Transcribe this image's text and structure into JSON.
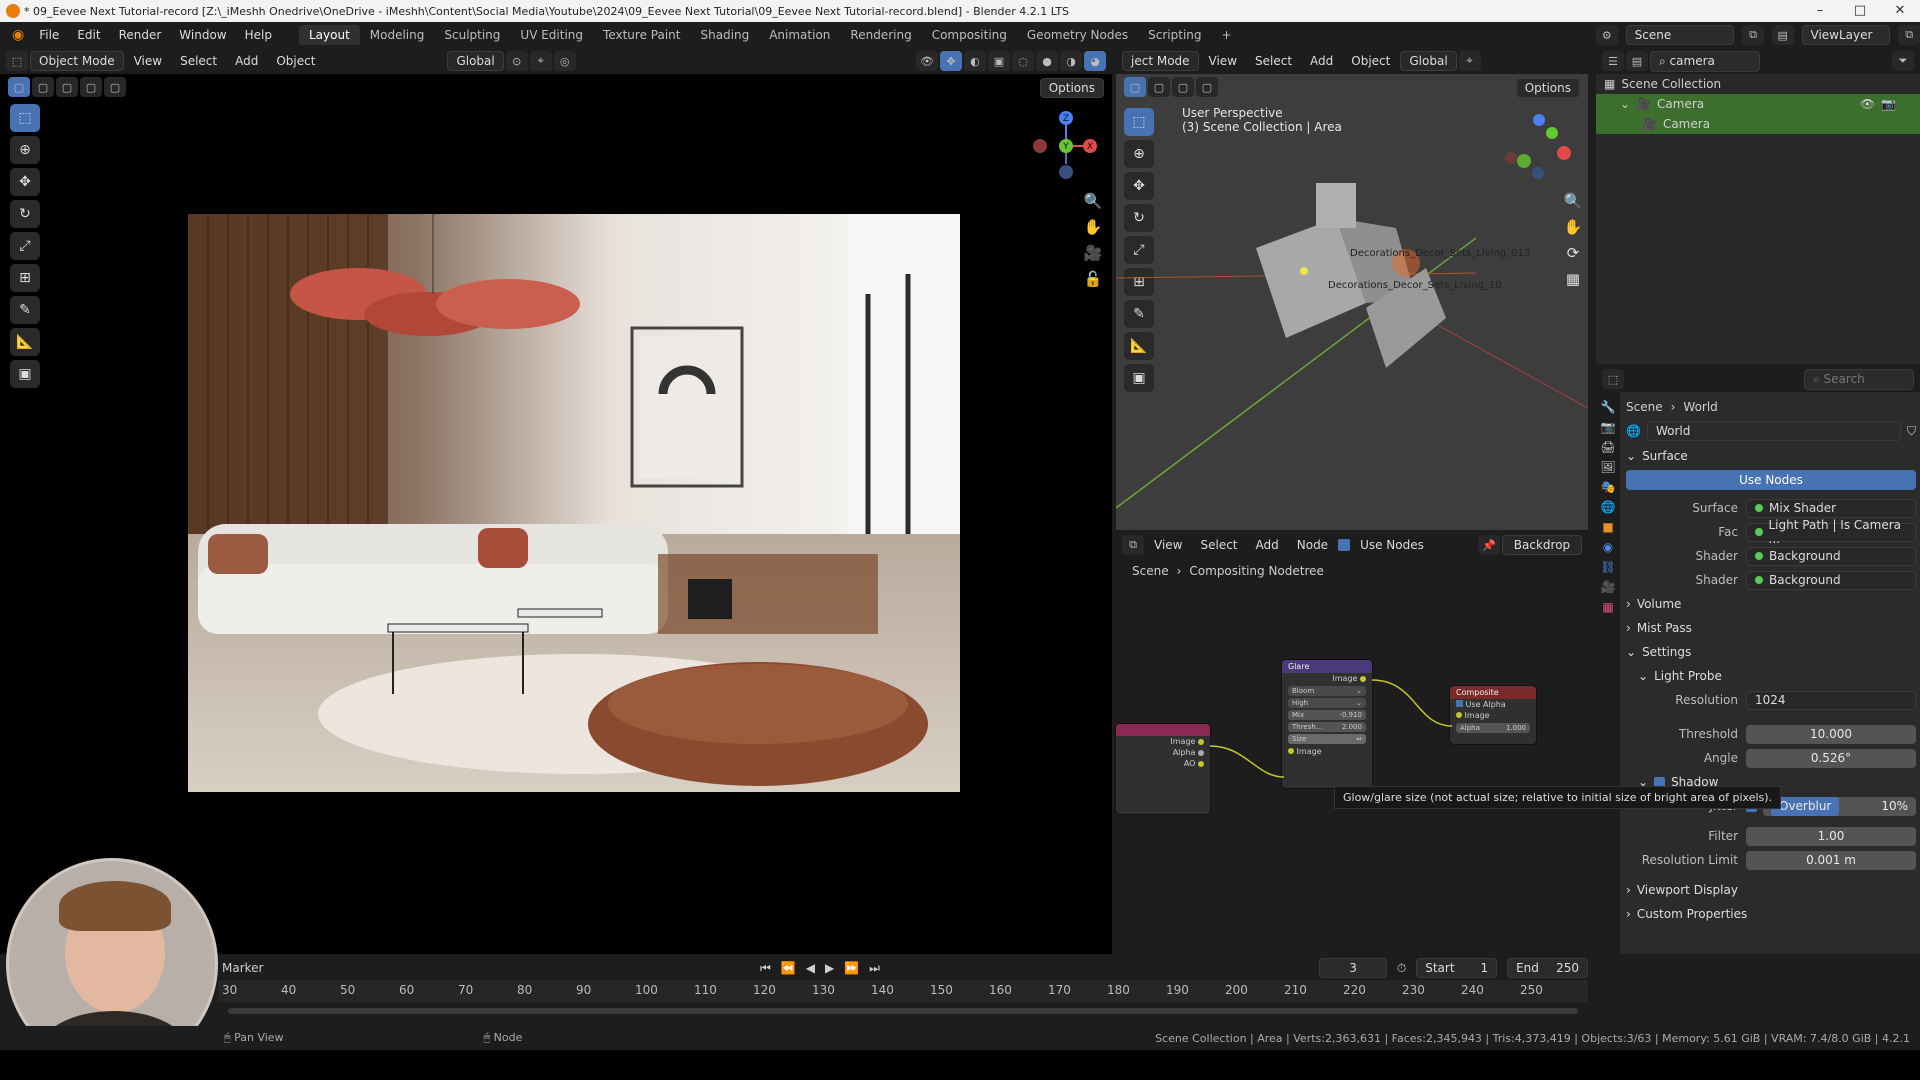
{
  "titlebar": {
    "title": "* 09_Eevee Next Tutorial-record [Z:\\_iMeshh Onedrive\\OneDrive - iMeshh\\Content\\Social Media\\Youtube\\2024\\09_Eevee Next Tutorial\\09_Eevee Next Tutorial-record.blend] - Blender 4.2.1 LTS"
  },
  "menu": [
    "File",
    "Edit",
    "Render",
    "Window",
    "Help"
  ],
  "workspaces": [
    "Layout",
    "Modeling",
    "Sculpting",
    "UV Editing",
    "Texture Paint",
    "Shading",
    "Animation",
    "Rendering",
    "Compositing",
    "Geometry Nodes",
    "Scripting"
  ],
  "active_workspace": "Layout",
  "topright": {
    "scene": "Scene",
    "viewlayer": "ViewLayer"
  },
  "left_view": {
    "mode": "Object Mode",
    "menus": [
      "View",
      "Select",
      "Add",
      "Object"
    ],
    "transform": "Global",
    "options": "Options"
  },
  "right_view": {
    "mode": "ject Mode",
    "menus": [
      "View",
      "Select",
      "Add",
      "Object"
    ],
    "transform": "Global",
    "options": "Options",
    "overlay_title": "User Perspective",
    "overlay_sub": "(3) Scene Collection | Area",
    "obj_label_1": "Decorations_Decor_Sets_Living_013",
    "obj_label_2": "Decorations_Decor_Sets_Living_10"
  },
  "gizmo": {
    "x": "X",
    "y": "Y",
    "z": "Z"
  },
  "node_editor": {
    "menus": [
      "View",
      "Select",
      "Add",
      "Node"
    ],
    "use_nodes": "Use Nodes",
    "backdrop": "Backdrop",
    "breadcrumb_scene": "Scene",
    "breadcrumb_tree": "Compositing Nodetree",
    "glare": {
      "title": "Glare",
      "out": "Image",
      "type": "Bloom",
      "quality": "High",
      "mix_label": "Mix",
      "mix": "-0.910",
      "thresh_label": "Thresh...",
      "thresh": "2.000",
      "size_label": "Size",
      "in": "Image"
    },
    "composite": {
      "title": "Composite",
      "use_alpha": "Use Alpha",
      "image": "Image",
      "alpha_label": "Alpha",
      "alpha": "1.000"
    },
    "rl_outputs": [
      "Image",
      "Alpha",
      "AO"
    ],
    "tooltip": "Glow/glare size (not actual size; relative to initial size of bright area of pixels)."
  },
  "outliner": {
    "search": "camera",
    "collection": "Scene Collection",
    "item": "Camera",
    "sub_item": "Camera"
  },
  "properties": {
    "search_placeholder": "Search",
    "crumb_scene": "Scene",
    "crumb_world": "World",
    "world_name": "World",
    "surface_panel": "Surface",
    "use_nodes": "Use Nodes",
    "surface_label": "Surface",
    "surface_val": "Mix Shader",
    "fac_label": "Fac",
    "fac_val": "Light Path | Is Camera ...",
    "shader_label": "Shader",
    "shader1": "Background",
    "shader2": "Background",
    "volume": "Volume",
    "mist": "Mist Pass",
    "settings": "Settings",
    "light_probe": "Light Probe",
    "resolution_label": "Resolution",
    "resolution_val": "1024",
    "threshold_label": "Threshold",
    "threshold_val": "10.000",
    "angle_label": "Angle",
    "angle_val": "0.526°",
    "shadow": "Shadow",
    "jitter_label": "Jitter",
    "overblur_label": "Overblur",
    "overblur_val": "10%",
    "filter_label": "Filter",
    "filter_val": "1.00",
    "reslimit_label": "Resolution Limit",
    "reslimit_val": "0.001 m",
    "viewport_display": "Viewport Display",
    "custom_props": "Custom Properties"
  },
  "timeline": {
    "marker": "Marker",
    "current_frame": "3",
    "start_label": "Start",
    "start": "1",
    "end_label": "End",
    "end": "250",
    "ticks": [
      "30",
      "40",
      "50",
      "60",
      "70",
      "80",
      "90",
      "100",
      "110",
      "120",
      "130",
      "140",
      "150",
      "160",
      "170",
      "180",
      "190",
      "200",
      "210",
      "220",
      "230",
      "240",
      "250"
    ]
  },
  "statusbar": {
    "left": "Pan View",
    "mid": "Node",
    "right": "Scene Collection | Area | Verts:2,363,631 | Faces:2,345,943 | Tris:4,373,419 | Objects:3/63 | Memory: 5.61 GiB | VRAM: 7.4/8.0 GiB | 4.2.1"
  },
  "colors": {
    "accent": "#4772b3",
    "orange": "#e87d0d",
    "green_row": "#3c6e2d"
  }
}
